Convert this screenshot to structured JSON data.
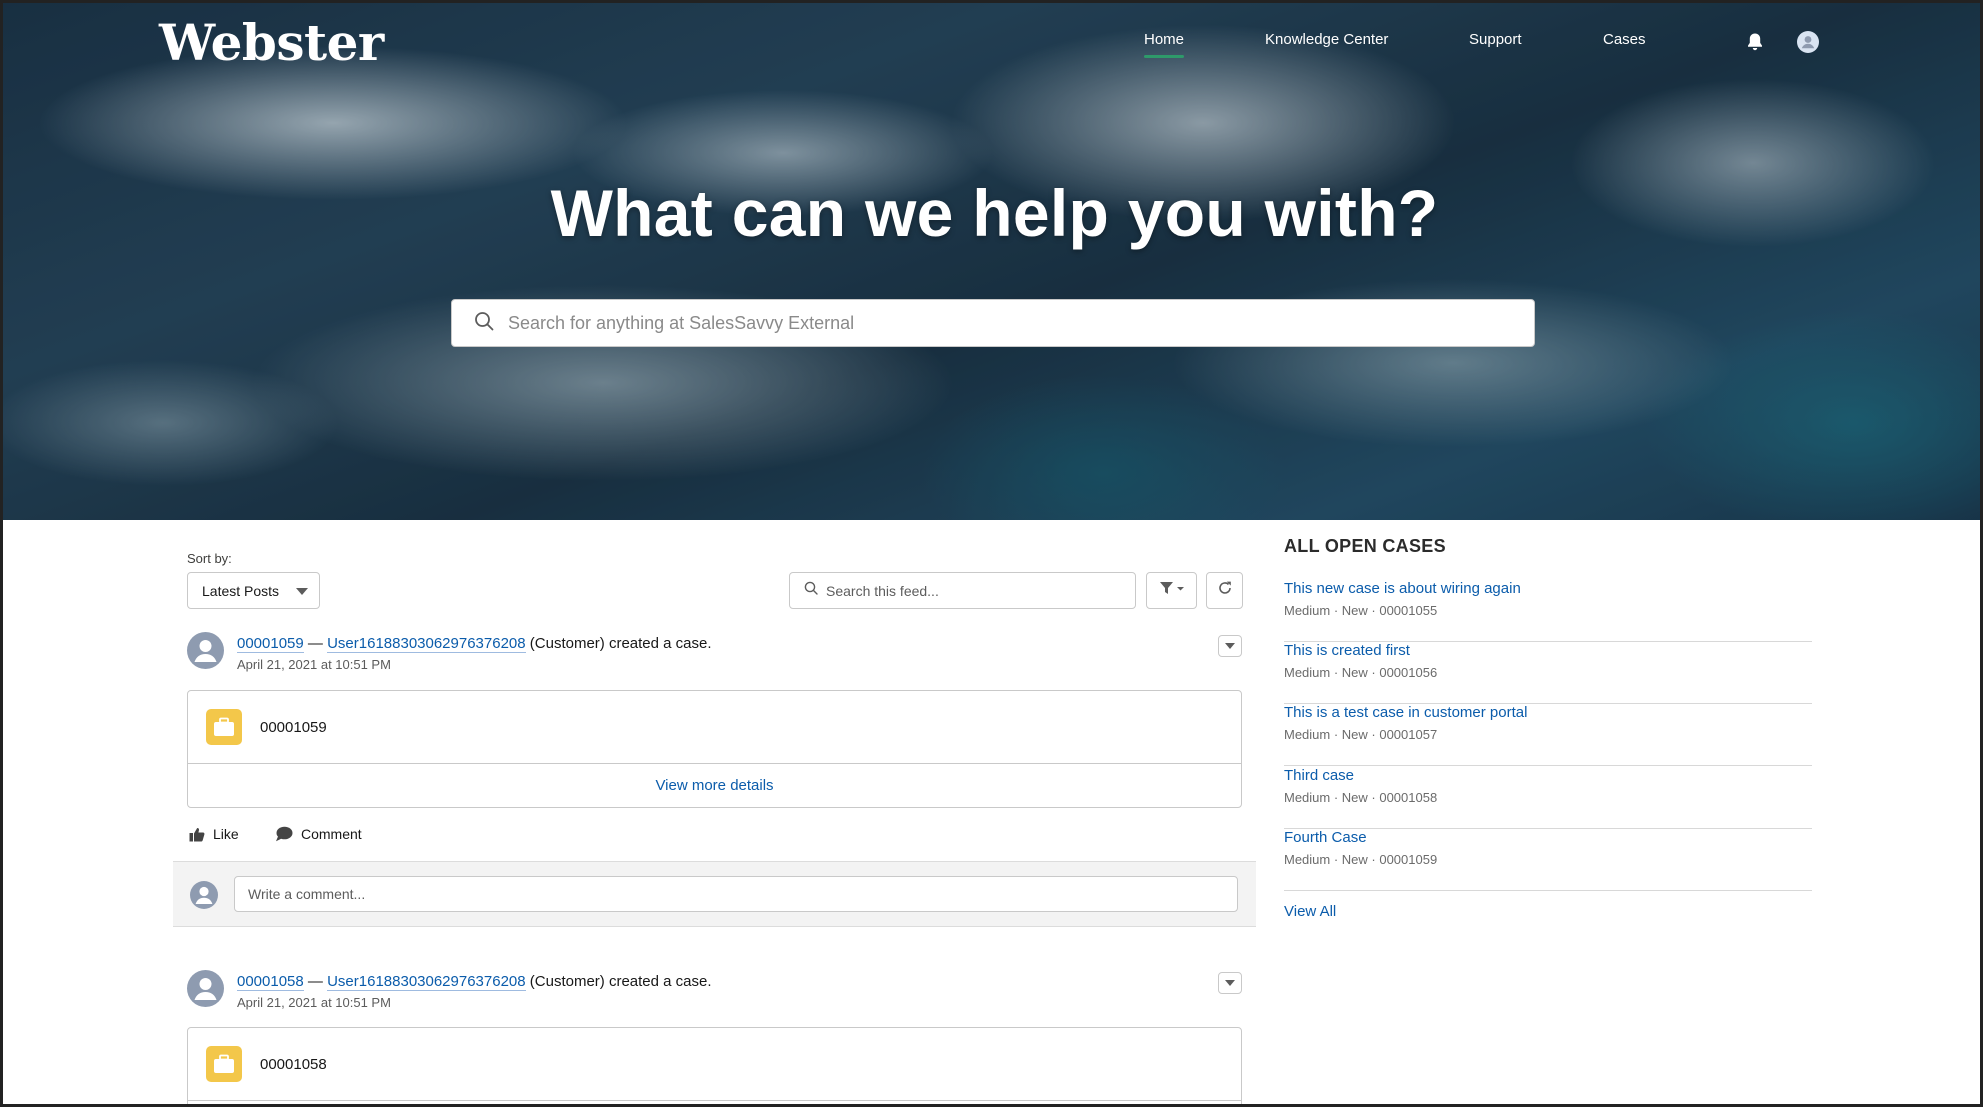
{
  "header": {
    "logo": "Webster",
    "nav": [
      {
        "label": "Home",
        "active": true
      },
      {
        "label": "Knowledge Center",
        "active": false
      },
      {
        "label": "Support",
        "active": false
      },
      {
        "label": "Cases",
        "active": false
      }
    ],
    "icons": [
      "bell-icon",
      "user-icon"
    ]
  },
  "hero": {
    "title": "What can we help you with?",
    "search_placeholder": "Search for anything at SalesSavvy External"
  },
  "feed": {
    "sort_label": "Sort by:",
    "sort_value": "Latest Posts",
    "search_placeholder": "Search this feed...",
    "posts": [
      {
        "case_link": "00001059",
        "separator": " — ",
        "user_link": "User16188303062976376208",
        "action_text": " (Customer) created a case.",
        "date": "April 21, 2021 at 10:51 PM",
        "case_number": "00001059",
        "details_link": "View more details"
      },
      {
        "case_link": "00001058",
        "separator": " — ",
        "user_link": "User16188303062976376208",
        "action_text": " (Customer) created a case.",
        "date": "April 21, 2021 at 10:51 PM",
        "case_number": "00001058"
      }
    ],
    "like_label": "Like",
    "comment_label": "Comment",
    "comment_placeholder": "Write a comment..."
  },
  "sidebar": {
    "title": "ALL OPEN CASES",
    "cases": [
      {
        "title": "This new case is about wiring again",
        "meta": "Medium · New · 00001055"
      },
      {
        "title": "This is created first",
        "meta": "Medium · New · 00001056"
      },
      {
        "title": "This is a test case in customer portal",
        "meta": "Medium · New · 00001057"
      },
      {
        "title": "Third case",
        "meta": "Medium · New · 00001058"
      },
      {
        "title": "Fourth Case",
        "meta": "Medium · New · 00001059"
      }
    ],
    "view_all": "View All"
  },
  "colors": {
    "link": "#0b5cab",
    "nav_active_underline": "#2e9a6a",
    "case_icon": "#f3c74a",
    "avatar": "#8e9bb0"
  }
}
